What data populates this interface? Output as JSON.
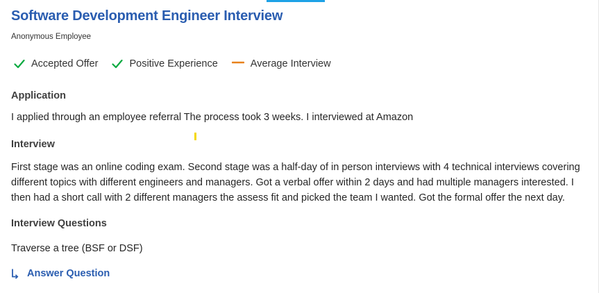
{
  "header": {
    "title": "Software Development Engineer Interview",
    "author": "Anonymous Employee"
  },
  "ratings": [
    {
      "label": "Accepted Offer",
      "icon": "check-icon",
      "color": "#0caa41"
    },
    {
      "label": "Positive Experience",
      "icon": "check-icon",
      "color": "#0caa41"
    },
    {
      "label": "Average Interview",
      "icon": "dash-icon",
      "color": "#e8811a"
    }
  ],
  "application": {
    "heading": "Application",
    "text": "I applied through an employee referral The process took 3 weeks. I interviewed at Amazon"
  },
  "interview": {
    "heading": "Interview",
    "text": "First stage was an online coding exam. Second stage was a half-day of in person interviews with 4 technical interviews covering different topics with different engineers and managers. Got a verbal offer within 2 days and had multiple managers interested. I then had a short call with 2 different managers the assess fit and picked the team I wanted. Got the formal offer the next day."
  },
  "questions": {
    "heading": "Interview Questions",
    "items": [
      "Traverse a tree (BSF or DSF)"
    ]
  },
  "answer_action": {
    "label": "Answer Question",
    "icon": "answer-arrow-icon"
  },
  "colors": {
    "link": "#2a5db0",
    "accent": "#1ea2e6",
    "positive": "#0caa41",
    "neutral": "#e8811a"
  }
}
